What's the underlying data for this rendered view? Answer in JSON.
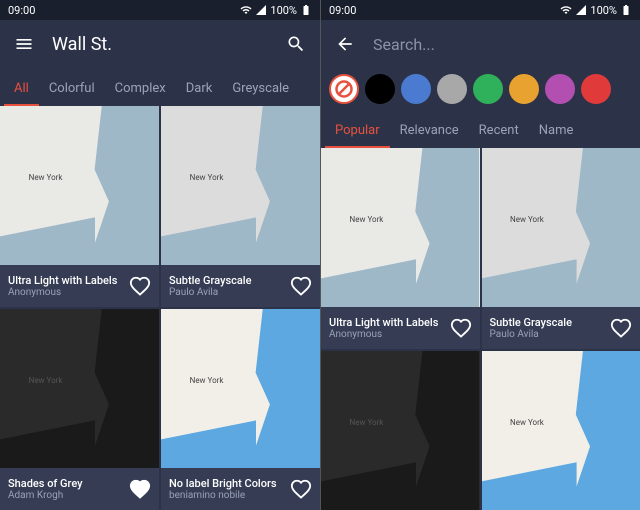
{
  "status": {
    "time": "09:00",
    "battery": "100%"
  },
  "left": {
    "title": "Wall St.",
    "tabs": [
      "All",
      "Colorful",
      "Complex",
      "Dark",
      "Greyscale"
    ],
    "activeTab": 0,
    "cards": [
      {
        "name": "Ultra Light with Labels",
        "author": "Anonymous",
        "fav": false,
        "style": "light"
      },
      {
        "name": "Subtle Grayscale",
        "author": "Paulo Avila",
        "fav": false,
        "style": "gray"
      },
      {
        "name": "Shades of Grey",
        "author": "Adam Krogh",
        "fav": true,
        "style": "dark"
      },
      {
        "name": "No label Bright Colors",
        "author": "beniamino nobile",
        "fav": false,
        "style": "color"
      }
    ]
  },
  "right": {
    "searchPlaceholder": "Search...",
    "colors": [
      "none",
      "#000000",
      "#4a7bd0",
      "#a8a8a8",
      "#2fb05a",
      "#e8a22f",
      "#b34fb0",
      "#e03a3a"
    ],
    "tabs": [
      "Popular",
      "Relevance",
      "Recent",
      "Name"
    ],
    "activeTab": 0,
    "cards": [
      {
        "name": "Ultra Light with Labels",
        "author": "Anonymous",
        "fav": false,
        "style": "light"
      },
      {
        "name": "Subtle Grayscale",
        "author": "Paulo Avila",
        "fav": false,
        "style": "gray"
      },
      {
        "name": "",
        "author": "",
        "fav": false,
        "style": "dark"
      },
      {
        "name": "",
        "author": "",
        "fav": false,
        "style": "color"
      }
    ]
  },
  "mapLabel": "New York"
}
